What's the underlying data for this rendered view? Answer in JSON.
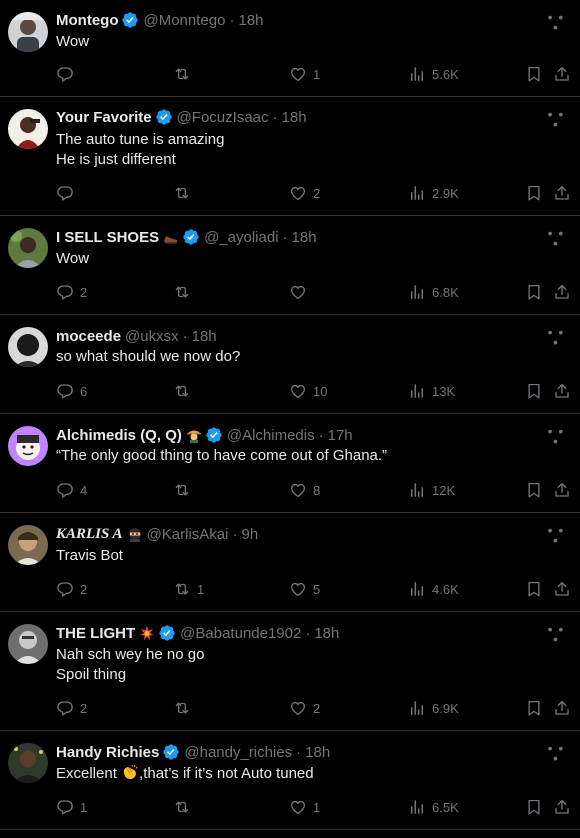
{
  "colors": {
    "background": "#000000",
    "text": "#e7e9ea",
    "muted": "#71767b",
    "divider": "#2f3336",
    "verified": "#1d9bf0"
  },
  "tweets": [
    {
      "name": "Montego",
      "verified": true,
      "handle": "@Monntego",
      "time": "18h",
      "lines": [
        "Wow"
      ],
      "replies": "",
      "retweets": "",
      "likes": "1",
      "views": "5.6K"
    },
    {
      "name": "Your Favorite",
      "verified": true,
      "handle": "@FocuzIsaac",
      "time": "18h",
      "lines": [
        "The auto tune is amazing",
        "He is just different"
      ],
      "replies": "",
      "retweets": "",
      "likes": "2",
      "views": "2.9K"
    },
    {
      "name": "I SELL SHOES",
      "name_emoji": "shoe-emoji",
      "verified": true,
      "handle": "@_ayoliadi",
      "time": "18h",
      "lines": [
        "Wow"
      ],
      "replies": "2",
      "retweets": "",
      "likes": "",
      "views": "6.8K"
    },
    {
      "name": "moceede",
      "verified": false,
      "handle": "@ukxsx",
      "time": "18h",
      "lines": [
        "so what should we now do?"
      ],
      "replies": "6",
      "retweets": "",
      "likes": "10",
      "views": "13K"
    },
    {
      "name": "Alchimedis (Q, Q)",
      "name_emoji": "farmer-emoji",
      "verified": true,
      "handle": "@Alchimedis",
      "time": "17h",
      "lines": [
        "“The only good thing to have come out of Ghana.”"
      ],
      "replies": "4",
      "retweets": "",
      "likes": "8",
      "views": "12K"
    },
    {
      "name": "KARLIS A",
      "name_emoji": "ninja-emoji",
      "verified": false,
      "handle": "@KarlisAkai",
      "time": "9h",
      "lines": [
        "Travis Bot"
      ],
      "replies": "2",
      "retweets": "1",
      "likes": "5",
      "views": "4.6K"
    },
    {
      "name": "THE LIGHT",
      "name_emoji": "collision-emoji",
      "verified": true,
      "handle": "@Babatunde1902",
      "time": "18h",
      "lines": [
        "Nah sch wey he no go",
        "Spoil thing"
      ],
      "replies": "2",
      "retweets": "",
      "likes": "2",
      "views": "6.9K"
    },
    {
      "name": "Handy Richies",
      "verified": true,
      "handle": "@handy_richies",
      "time": "18h",
      "lines_pre": "Excellent ",
      "lines_emoji": "clapping-hands-emoji",
      "lines_post": ",that’s if it’s not Auto tuned",
      "replies": "1",
      "retweets": "",
      "likes": "1",
      "views": "6.5K"
    }
  ],
  "separator": "·"
}
